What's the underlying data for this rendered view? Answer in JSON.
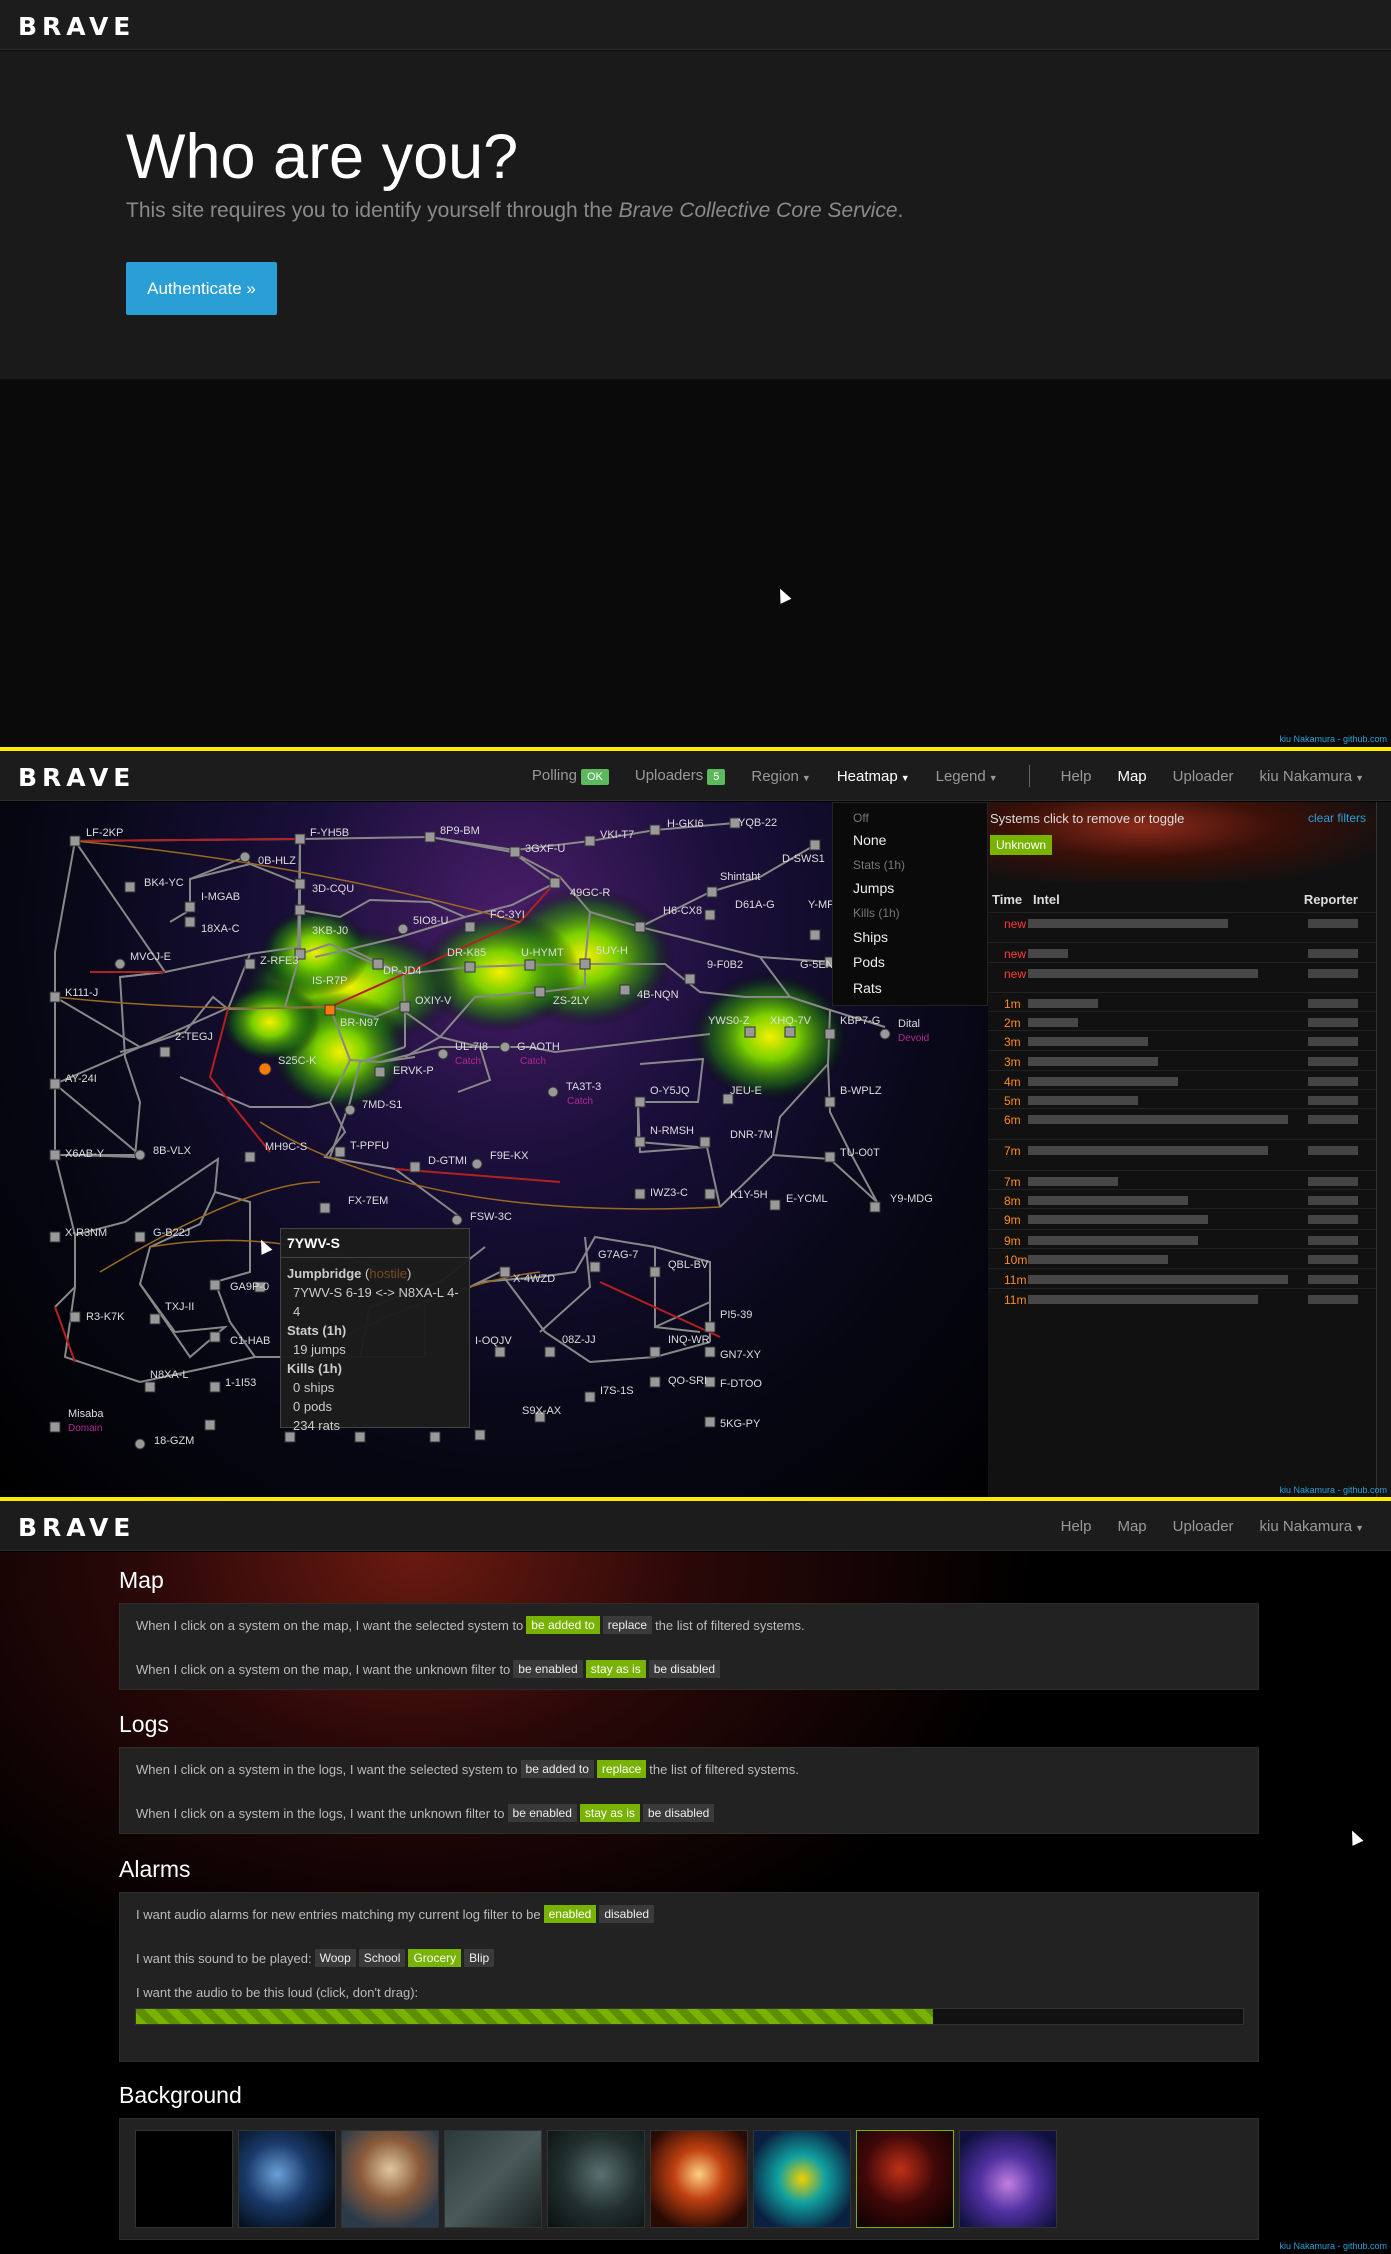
{
  "brand": "BRAVE",
  "credit": "kiu Nakamura - github.com",
  "login": {
    "title": "Who are you?",
    "lead_before": "This site requires you to identify yourself through the ",
    "lead_em": "Brave Collective Core Service",
    "lead_after": ".",
    "button": "Authenticate »"
  },
  "map_nav": {
    "polling": "Polling",
    "polling_badge": "OK",
    "uploaders": "Uploaders",
    "uploaders_badge": "5",
    "region": "Region",
    "heatmap": "Heatmap",
    "legend": "Legend",
    "help": "Help",
    "map": "Map",
    "uploader": "Uploader",
    "user": "kiu Nakamura"
  },
  "heatmap_menu": {
    "off": "Off",
    "none": "None",
    "stats_header": "Stats (1h)",
    "jumps": "Jumps",
    "kills_header": "Kills (1h)",
    "ships": "Ships",
    "pods": "Pods",
    "rats": "Rats"
  },
  "intel": {
    "tip": "Systems click to remove or toggle",
    "clear": "clear filters",
    "unknown": "Unknown",
    "col_time": "Time",
    "col_intel": "Intel",
    "col_reporter": "Reporter",
    "rows": [
      "new",
      "new",
      "new",
      "1m",
      "2m",
      "3m",
      "3m",
      "4m",
      "5m",
      "6m",
      "7m",
      "7m",
      "8m",
      "9m",
      "9m",
      "10m",
      "11m",
      "11m"
    ]
  },
  "systems": {
    "s01": "LF-2KP",
    "s02": "BK4-YC",
    "s03": "I-MGAB",
    "s04": "0B-HLZ",
    "s05": "F-YH5B",
    "s06": "8P9-BM",
    "s07": "3GXF-U",
    "s08": "VKI-T7",
    "s09": "H-GKI6",
    "s10": "YQB-22",
    "s11": "18XA-C",
    "s12": "3D-CQU",
    "s13": "MVCJ-E",
    "s14": "Z-RFE3",
    "s15": "3KB-J0",
    "s16": "5IO8-U",
    "s17": "FC-3YI",
    "s18": "49GC-R",
    "s19": "Shintaht",
    "s20": "D-SWS1",
    "s21": "K111-J",
    "s22": "IS-R7P",
    "s23": "DP-JD4",
    "s24": "DR-K85",
    "s25": "U-HYMT",
    "s26": "5UY-H",
    "s27": "H6-CX8",
    "s28": "D61A-G",
    "s29": "Y-MP",
    "s30": "2-TEGJ",
    "s31": "BR-N97",
    "s32": "OXIY-V",
    "s33": "ZS-2LY",
    "s34": "4B-NQN",
    "s35": "9-F0B2",
    "s36": "G-5EN",
    "s37": "AY-24I",
    "s38": "S25C-K",
    "s39": "ERVK-P",
    "s40": "UL-7I8",
    "s41": "G-AOTH",
    "s42": "YWS0-Z",
    "s43": "XHQ-7V",
    "s44": "KBP7-G",
    "s45": "Dital",
    "s46": "X6AB-Y",
    "s47": "8B-VLX",
    "s48": "MH9C-S",
    "s49": "7MD-S1",
    "s50": "T-PPFU",
    "s51": "TA3T-3",
    "s52": "O-Y5JQ",
    "s53": "JEU-E",
    "s54": "B-WPLZ",
    "s55": "N-RMSH",
    "s56": "DNR-7M",
    "s57": "TU-O0T",
    "s58": "D-GTMI",
    "s59": "F9E-KX",
    "s60": "IWZ3-C",
    "s61": "K1Y-5H",
    "s62": "E-YCML",
    "s63": "Y9-MDG",
    "s64": "X-R3NM",
    "s65": "G-B22J",
    "s66": "FX-7EM",
    "s67": "FSW-3C",
    "s68": "G7AG-7",
    "s69": "QBL-BV",
    "s70": "X-4WZD",
    "s71": "R3-K7K",
    "s72": "GA9P-0",
    "s73": "TXJ-II",
    "s74": "C1-HAB",
    "s75": "I-OQJV",
    "s76": "08Z-JJ",
    "s77": "INQ-WR",
    "s78": "PI5-39",
    "s79": "GN7-XY",
    "s80": "N8XA-L",
    "s81": "1-1I53",
    "s82": "I7S-1S",
    "s83": "QO-SRI",
    "s84": "F-DTOO",
    "s85": "S9X-AX",
    "s86": "5KG-PY",
    "s87": "Misaba",
    "s88": "18-GZM"
  },
  "map_labels": {
    "catch1": "Catch",
    "catch2": "Catch",
    "catch3": "Catch",
    "devoid": "Devoid",
    "domain": "Domain"
  },
  "tooltip": {
    "title": "7YWV-S",
    "jumpbridge_label": "Jumpbridge",
    "jumpbridge_status": "hostile",
    "jumpbridge_route": "7YWV-S 6-19 <-> N8XA-L 4-4",
    "stats_label": "Stats (1h)",
    "jumps": "19 jumps",
    "kills_label": "Kills (1h)",
    "ships": "0 ships",
    "pods": "0 pods",
    "rats": "234 rats"
  },
  "settings_nav": {
    "help": "Help",
    "map": "Map",
    "uploader": "Uploader",
    "user": "kiu Nakamura"
  },
  "settings": {
    "map_title": "Map",
    "map_line1_a": "When I click on a system on the map, I want the selected system to",
    "map_line1_b": "the list of filtered systems.",
    "map_line2": "When I click on a system on the map, I want the unknown filter to",
    "logs_title": "Logs",
    "logs_line1_a": "When I click on a system in the logs, I want the selected system to",
    "logs_line1_b": "the list of filtered systems.",
    "logs_line2": "When I click on a system in the logs, I want the unknown filter to",
    "alarms_title": "Alarms",
    "alarms_line1": "I want audio alarms for new entries matching my current log filter to be",
    "alarms_line2": "I want this sound to be played:",
    "alarms_line3": "I want the audio to be this loud (click, don't drag):",
    "volume": 0.72,
    "bg_title": "Background",
    "opt_added": "be added to",
    "opt_replace": "replace",
    "opt_enabled": "be enabled",
    "opt_stay": "stay as is",
    "opt_disabled": "be disabled",
    "opt_en": "enabled",
    "opt_dis": "disabled",
    "sound_woop": "Woop",
    "sound_school": "School",
    "sound_grocery": "Grocery",
    "sound_blip": "Blip"
  }
}
